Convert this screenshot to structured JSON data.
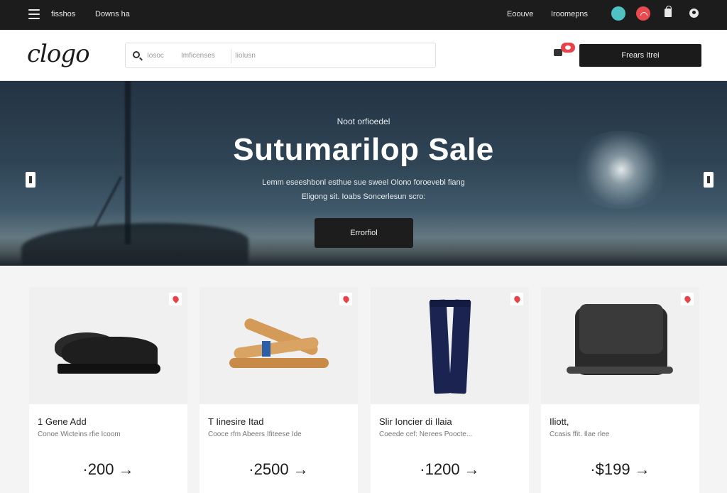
{
  "topbar": {
    "link_left_1": "fisshos",
    "link_left_2": "Downs ha",
    "link_right_1": "Eoouve",
    "link_right_2": "Iroomepns"
  },
  "header": {
    "logo": "clogo",
    "search": {
      "placeholder_1": "Iosoc",
      "placeholder_2": "Imficenses",
      "placeholder_3": "Iiolusn"
    },
    "cta_label": "Frears Itrei"
  },
  "hero": {
    "kicker": "Noot orfioedel",
    "title": "Sutumarilop Sale",
    "subtitle_line1": "Lemm eseeshbonl esthue sue sweel Olono foroevebl fiang",
    "subtitle_line2": "Eligong sit. Ioabs Soncerlesun scro:",
    "button_label": "Errorfiol"
  },
  "products": [
    {
      "name": "1 Gene Add",
      "desc": "Conoe Wicteins rfie Icoom",
      "price": "·200 →",
      "image": "black-leather-shoes"
    },
    {
      "name": "T Iinesire Itad",
      "desc": "Cooce rfm Abeers Ifiteese Ide",
      "price": "·2500 →",
      "image": "tan-sandal"
    },
    {
      "name": "Slir Ioncier di Ilaia",
      "desc": "Coeede cef: Nerees Poocte...",
      "price": "·1200 →",
      "image": "navy-trousers"
    },
    {
      "name": "Iliott,",
      "desc": "Ccasis ffit. Ilae rlee",
      "price": "·$199 →",
      "image": "black-handbag"
    }
  ],
  "icons": {
    "menu": "hamburger-menu-icon",
    "search": "search-icon",
    "cart": "cart-icon",
    "favorite": "heart-icon",
    "bag": "shopping-bag-icon",
    "user": "user-icon"
  },
  "colors": {
    "topbar": "#1c1c1c",
    "accent_red": "#e8424a",
    "accent_teal": "#4fc3c3",
    "button_dark": "#1b1b1b"
  }
}
